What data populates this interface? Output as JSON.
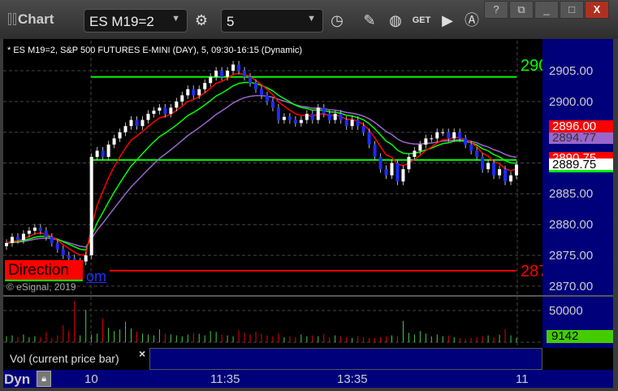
{
  "toolbar": {
    "title": "Chart",
    "symbol": "ES M19=2",
    "interval": "5",
    "icons": [
      "gear-icon",
      "clock-icon",
      "pencil-icon",
      "chart-line-icon",
      "get-icon",
      "play-icon",
      "a-icon"
    ]
  },
  "window": {
    "help": "?",
    "restore": "⧉",
    "minimize": "_",
    "maximize": "□",
    "close": "X"
  },
  "chart": {
    "header": "* ES M19=2, S&P 500 FUTURES E-MINI (DAY), 5, 09:30-16:15 (Dynamic)",
    "copyright": "© eSignal, 2019",
    "direction_label": "Direction",
    "partial_label": "om",
    "line_label_top": "290",
    "line_label_bottom": "287"
  },
  "price_axis": {
    "ticks": [
      "2905.00",
      "2900.00",
      "2885.00",
      "2880.00",
      "2875.00",
      "2870.00"
    ],
    "tags": {
      "red": "2896.00",
      "purple": "2894.77",
      "red2": "2890.75",
      "last": "2889.75"
    }
  },
  "volume": {
    "tick": "50000",
    "last": "9142",
    "legend": "Vol (current price bar)",
    "close": "×"
  },
  "time_axis": {
    "dyn": "Dyn",
    "labels": [
      "10",
      "11:35",
      "13:35",
      "11"
    ]
  },
  "chart_data": {
    "type": "candlestick",
    "ylim": [
      2869,
      2908
    ],
    "closes": [
      2877,
      2878,
      2877.5,
      2878.5,
      2879,
      2879.5,
      2879,
      2878,
      2877,
      2876,
      2875,
      2874.5,
      2874,
      2874,
      2875,
      2891,
      2892,
      2891,
      2893,
      2894,
      2895,
      2896,
      2897,
      2896,
      2897,
      2898,
      2898.5,
      2899,
      2898,
      2899,
      2900,
      2901,
      2902,
      2901,
      2902,
      2903,
      2904,
      2905,
      2904,
      2905,
      2906,
      2905,
      2904,
      2903,
      2902,
      2901,
      2900,
      2899,
      2897,
      2897.5,
      2897,
      2896.5,
      2897,
      2898,
      2897,
      2899,
      2898,
      2897,
      2898,
      2897,
      2896,
      2897,
      2896,
      2895,
      2893,
      2891,
      2889,
      2888,
      2890,
      2887,
      2889,
      2891,
      2892,
      2893,
      2894,
      2894,
      2895,
      2895,
      2894,
      2895,
      2894,
      2893,
      2892,
      2891,
      2889,
      2890,
      2888,
      2889,
      2887,
      2888,
      2889.75
    ],
    "volumes": [
      7,
      8,
      6,
      9,
      6,
      7,
      6,
      12,
      5,
      8,
      20,
      14,
      48,
      8,
      38,
      9,
      10,
      28,
      17,
      13,
      15,
      24,
      16,
      12,
      10,
      9,
      8,
      15,
      10,
      9,
      8,
      7,
      9,
      11,
      10,
      8,
      13,
      12,
      9,
      8,
      7,
      14,
      11,
      9,
      12,
      10,
      8,
      7,
      10,
      6,
      7,
      6,
      9,
      7,
      8,
      7,
      10,
      6,
      8,
      7,
      6,
      5,
      7,
      6,
      5,
      5,
      6,
      7,
      8,
      7,
      25,
      11,
      9,
      13,
      10,
      7,
      9,
      7,
      8,
      6,
      5,
      4,
      5,
      6,
      7,
      8,
      6,
      9,
      15,
      8,
      12,
      25,
      12,
      40,
      14,
      9,
      6,
      7,
      9142
    ],
    "hlines": [
      {
        "price": 2904,
        "color": "#00ff00"
      },
      {
        "price": 2890.5,
        "color": "#00ff00"
      },
      {
        "price": 2872.5,
        "color": "#ff0000"
      }
    ]
  }
}
